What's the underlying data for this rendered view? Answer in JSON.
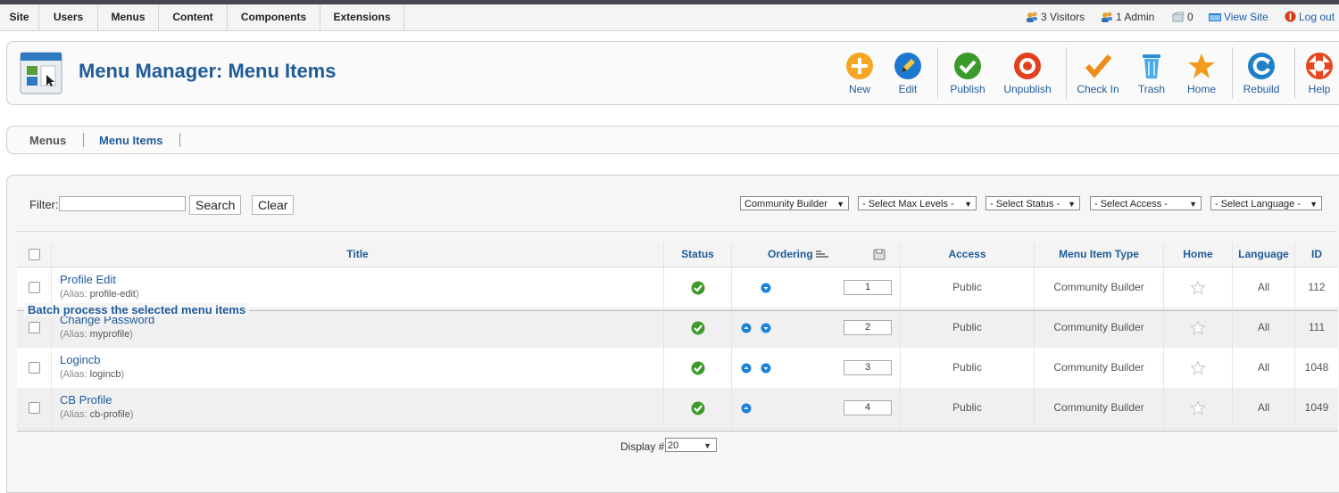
{
  "menubar": {
    "items": [
      "Site",
      "Users",
      "Menus",
      "Content",
      "Components",
      "Extensions"
    ],
    "status": {
      "visitors": "3 Visitors",
      "admins": "1 Admin",
      "messages": "0",
      "view_site": "View Site",
      "logout": "Log out"
    }
  },
  "header": {
    "title": "Menu Manager: Menu Items",
    "toolbar": {
      "new": "New",
      "edit": "Edit",
      "publish": "Publish",
      "unpublish": "Unpublish",
      "checkin": "Check In",
      "trash": "Trash",
      "home": "Home",
      "rebuild": "Rebuild",
      "help": "Help"
    }
  },
  "subnav": {
    "menus": "Menus",
    "menu_items": "Menu Items"
  },
  "filter": {
    "label": "Filter:",
    "value": "",
    "search_label": "Search",
    "clear_label": "Clear",
    "menu_select": "Community Builder",
    "max_levels": "- Select Max Levels -",
    "status": "- Select Status -",
    "access": "- Select Access -",
    "language": "- Select Language -"
  },
  "table": {
    "columns": {
      "title": "Title",
      "status": "Status",
      "ordering": "Ordering",
      "access": "Access",
      "type": "Menu Item Type",
      "home": "Home",
      "language": "Language",
      "id": "ID"
    },
    "alias_prefix": "(Alias: ",
    "alias_suffix": ")",
    "rows": [
      {
        "title": "Profile Edit",
        "alias": "profile-edit",
        "order": "1",
        "access": "Public",
        "type": "Community Builder",
        "language": "All",
        "id": "112"
      },
      {
        "title": "Change Password",
        "alias": "myprofile",
        "order": "2",
        "access": "Public",
        "type": "Community Builder",
        "language": "All",
        "id": "111"
      },
      {
        "title": "Logincb",
        "alias": "logincb",
        "order": "3",
        "access": "Public",
        "type": "Community Builder",
        "language": "All",
        "id": "1048"
      },
      {
        "title": "CB Profile",
        "alias": "cb-profile",
        "order": "4",
        "access": "Public",
        "type": "Community Builder",
        "language": "All",
        "id": "1049"
      }
    ]
  },
  "pagination": {
    "display_label": "Display #",
    "display_value": "20"
  },
  "batch": {
    "legend": "Batch process the selected menu items"
  }
}
